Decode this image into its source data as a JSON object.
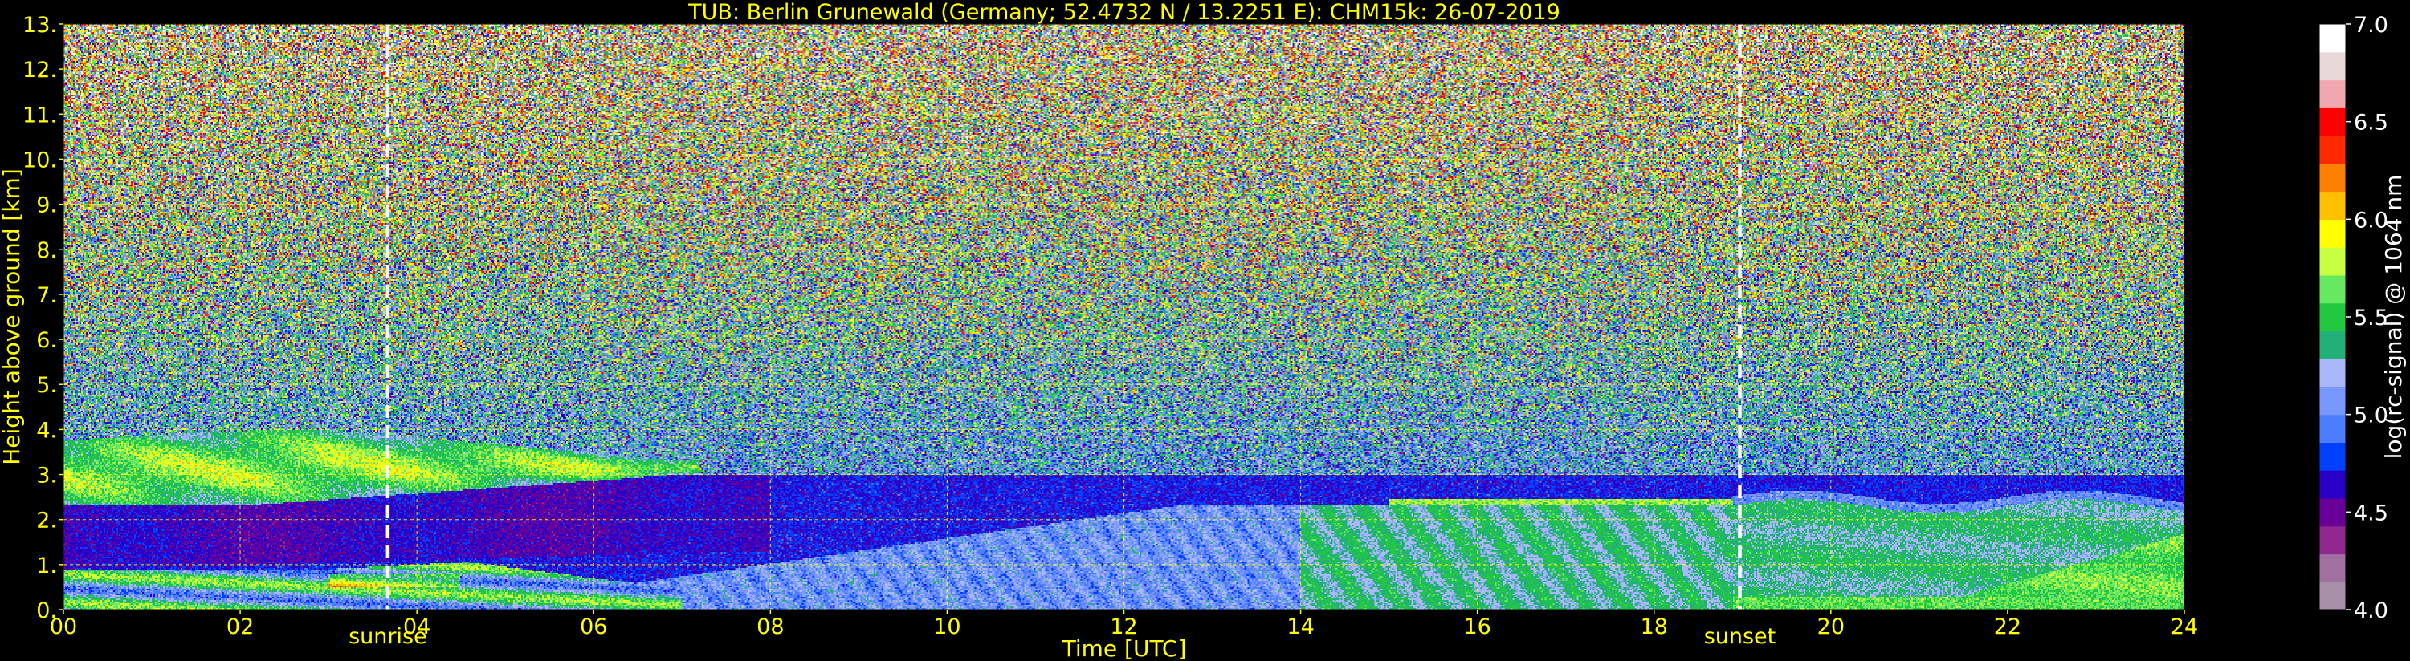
{
  "chart_data": {
    "type": "heatmap",
    "title": "TUB: Berlin Grunewald (Germany; 52.4732 N / 13.2251 E):    CHM15k: 26-07-2019",
    "xlabel": "Time [UTC]",
    "ylabel": "Height above ground [km]",
    "colorbar_label": "log(rc-signal) @ 1064 nm",
    "xlim": [
      0,
      24
    ],
    "ylim": [
      0,
      13
    ],
    "xticks": [
      0,
      2,
      4,
      6,
      8,
      10,
      12,
      14,
      16,
      18,
      20,
      22,
      24
    ],
    "xtick_labels": [
      "00",
      "02",
      "04",
      "06",
      "08",
      "10",
      "12",
      "14",
      "16",
      "18",
      "20",
      "22",
      "24"
    ],
    "yticks": [
      0,
      1,
      2,
      3,
      4,
      5,
      6,
      7,
      8,
      9,
      10,
      11,
      12,
      13
    ],
    "ytick_labels": [
      "0.",
      "1.",
      "2.",
      "3.",
      "4.",
      "5.",
      "6.",
      "7.",
      "8.",
      "9.",
      "10.",
      "11.",
      "12.",
      "13."
    ],
    "colorbar_range": [
      4.0,
      7.0
    ],
    "colorbar_ticks": [
      4.0,
      4.5,
      5.0,
      5.5,
      6.0,
      6.5,
      7.0
    ],
    "colorbar_tick_labels": [
      "4.0",
      "4.5",
      "5.0",
      "5.5",
      "6.0",
      "6.5",
      "7.0"
    ],
    "grid": true,
    "grid_color": "#ffff00",
    "markers": [
      {
        "label": "sunrise",
        "time": 3.67
      },
      {
        "label": "sunset",
        "time": 18.97
      }
    ],
    "colormap": [
      "#a890a8",
      "#a070a0",
      "#902890",
      "#6a0098",
      "#2a00c8",
      "#0040ff",
      "#4c7cff",
      "#7898ff",
      "#a8b8f8",
      "#22b078",
      "#22c840",
      "#66e860",
      "#c8ff40",
      "#ffff00",
      "#ffc000",
      "#ff8000",
      "#ff2a00",
      "#ff0000",
      "#f0a8b0",
      "#e8d8d8",
      "#ffffff"
    ]
  }
}
